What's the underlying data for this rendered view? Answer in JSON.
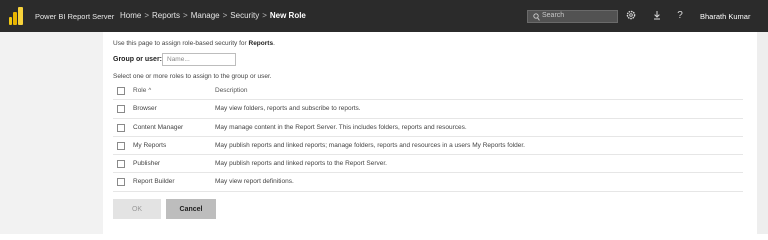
{
  "topbar": {
    "app_name": "Power BI Report Server",
    "breadcrumb": [
      "Home",
      "Reports",
      "Manage",
      "Security"
    ],
    "breadcrumb_current": "New Role",
    "search_placeholder": "Search",
    "user_name": "Bharath Kumar",
    "icons": [
      "settings-icon",
      "download-icon",
      "help-icon"
    ],
    "help_glyph": "?"
  },
  "form": {
    "intro_text": "Use this page to assign role-based security for",
    "intro_target": "Reports",
    "group_label": "Group or user:",
    "group_placeholder": "Name...",
    "select_hint": "Select one or more roles to assign to the group or user."
  },
  "table": {
    "headers": {
      "role": "Role",
      "description": "Description"
    },
    "rows": [
      {
        "role": "Browser",
        "description": "May view folders, reports and subscribe to reports."
      },
      {
        "role": "Content Manager",
        "description": "May manage content in the Report Server. This includes folders, reports and resources."
      },
      {
        "role": "My Reports",
        "description": "May publish reports and linked reports; manage folders, reports and resources in a users My Reports folder."
      },
      {
        "role": "Publisher",
        "description": "May publish reports and linked reports to the Report Server."
      },
      {
        "role": "Report Builder",
        "description": "May view report definitions."
      }
    ]
  },
  "buttons": {
    "ok": "OK",
    "cancel": "Cancel"
  },
  "colors": {
    "topbar": "#2b2b2b",
    "brand": "#f2c811",
    "sidebar": "#f2f2f2",
    "cancel_button": "#bdbdbd"
  }
}
